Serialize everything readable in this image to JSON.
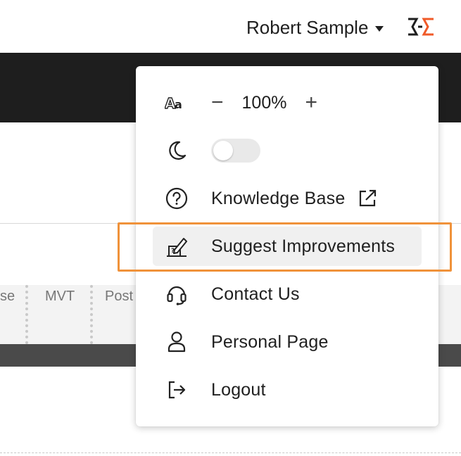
{
  "header": {
    "user_name": "Robert Sample",
    "logo_name": "app-logo",
    "logo_colors": {
      "dark": "#1e1e1e",
      "accent": "#f05a28"
    }
  },
  "background": {
    "columns": [
      "se",
      "MVT",
      "Post"
    ]
  },
  "dropdown": {
    "zoom": {
      "value": "100%",
      "minus": "−",
      "plus": "+"
    },
    "dark_mode": {
      "enabled": false
    },
    "items": [
      {
        "label": "Knowledge Base",
        "icon": "question-circle-icon",
        "external": true
      },
      {
        "label": "Suggest Improvements",
        "icon": "edit-suggest-icon",
        "highlighted": true
      },
      {
        "label": "Contact Us",
        "icon": "headset-icon"
      },
      {
        "label": "Personal Page",
        "icon": "user-icon"
      },
      {
        "label": "Logout",
        "icon": "logout-icon"
      }
    ]
  },
  "annotation": {
    "highlight_color": "#f0923a"
  }
}
